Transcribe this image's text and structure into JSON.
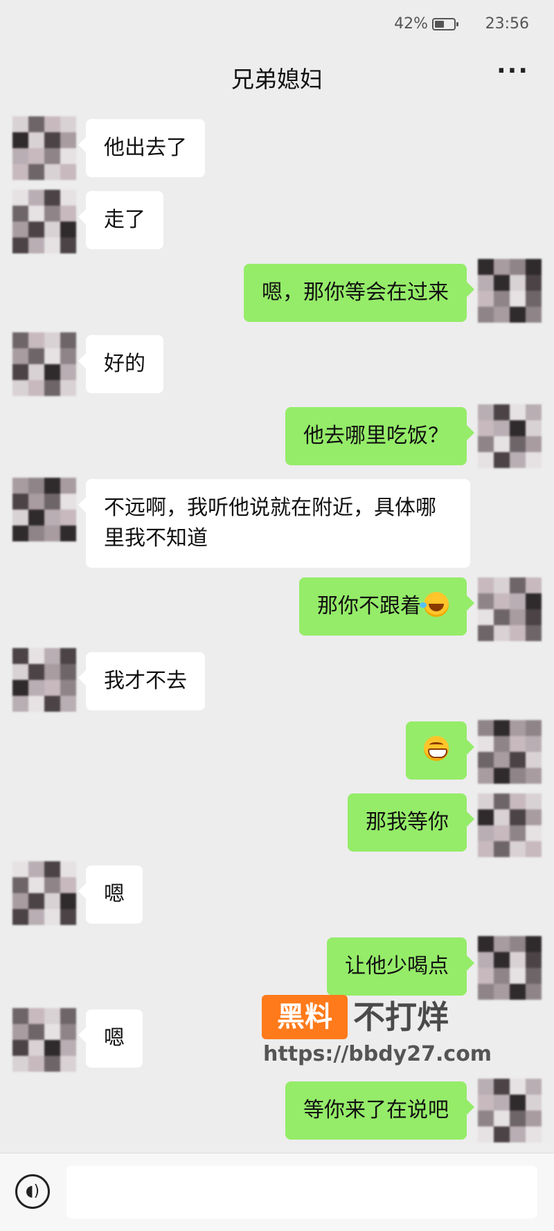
{
  "status_bar": {
    "battery": "42%",
    "time": "23:56",
    "battery_icon": "battery-icon"
  },
  "header": {
    "title": "兄弟媳妇",
    "more_label": "···"
  },
  "messages": [
    {
      "side": "left",
      "text": "他出去了"
    },
    {
      "side": "left",
      "text": "走了"
    },
    {
      "side": "right",
      "text": "嗯，那你等会在过来"
    },
    {
      "side": "left",
      "text": "好的"
    },
    {
      "side": "right",
      "text": "他去哪里吃饭？"
    },
    {
      "side": "left",
      "text": "不远啊，我听他说就在附近，具体哪里我不知道"
    },
    {
      "side": "right",
      "text": "那你不跟着",
      "emoji": "laughing-tears-emoji"
    },
    {
      "side": "left",
      "text": "我才不去"
    },
    {
      "side": "right",
      "text": "",
      "emoji": "grinning-emoji"
    },
    {
      "side": "right",
      "text": "那我等你"
    },
    {
      "side": "left",
      "text": "嗯"
    },
    {
      "side": "right",
      "text": "让他少喝点"
    },
    {
      "side": "left",
      "text": "嗯"
    },
    {
      "side": "right",
      "text": "等你来了在说吧"
    }
  ],
  "watermark": {
    "badge": "黑料",
    "text": "不打烊",
    "url": "https://bbdy27.com"
  },
  "input_bar": {
    "voice_icon": "voice-icon",
    "placeholder": ""
  },
  "colors": {
    "background": "#ededed",
    "sent_bubble": "#95ec69",
    "received_bubble": "#ffffff",
    "watermark_accent": "#ff7a1a"
  }
}
